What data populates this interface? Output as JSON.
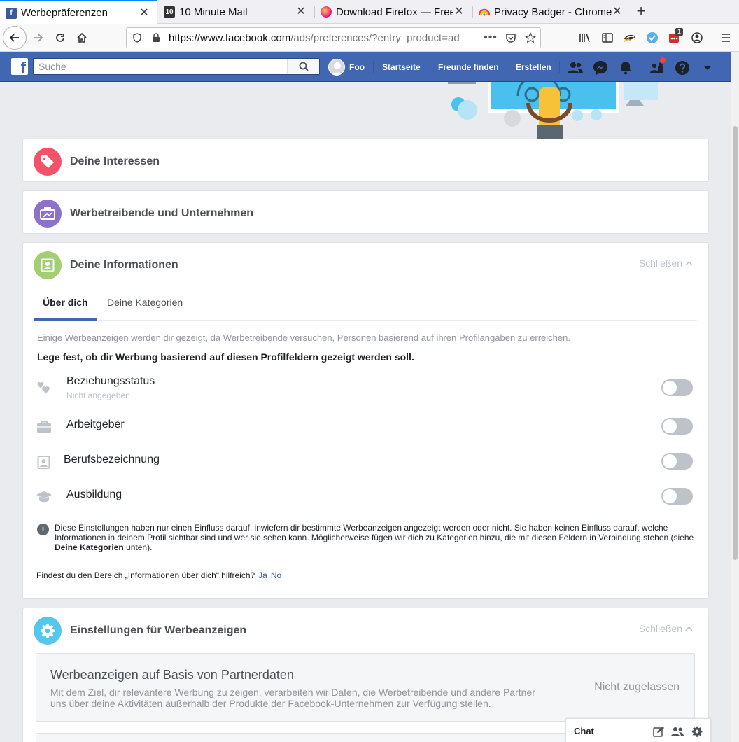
{
  "browser": {
    "tabs": [
      {
        "title": "Werbepräferenzen",
        "active": true
      },
      {
        "title": "10 Minute Mail",
        "active": false
      },
      {
        "title": "Download Firefox — Free",
        "active": false
      },
      {
        "title": "Privacy Badger - Chrome",
        "active": false
      }
    ],
    "url_host": "https://www.facebook.com",
    "url_path": "/ads/preferences/?entry_product=ad",
    "extension_badge": "1"
  },
  "fb": {
    "search_placeholder": "Suche",
    "profile_name": "Foo",
    "nav": {
      "home": "Startseite",
      "find_friends": "Freunde finden",
      "create": "Erstellen"
    }
  },
  "sections": {
    "interests": "Deine Interessen",
    "advertisers": "Werbetreibende und Unternehmen",
    "info": {
      "title": "Deine Informationen",
      "close": "Schließen",
      "tabs": [
        "Über dich",
        "Deine Kategorien"
      ],
      "intro": "Einige Werbeanzeigen werden dir gezeigt, da Werbetreibende versuchen, Personen basierend auf ihren Profilangaben zu erreichen.",
      "instruction": "Lege fest, ob dir Werbung basierend auf diesen Profilfeldern gezeigt werden soll.",
      "fields": [
        {
          "label": "Beziehungsstatus",
          "sub": "Nicht angegeben",
          "enabled": false
        },
        {
          "label": "Arbeitgeber",
          "sub": "",
          "enabled": false
        },
        {
          "label": "Berufsbezeichnung",
          "sub": "",
          "enabled": false
        },
        {
          "label": "Ausbildung",
          "sub": "",
          "enabled": false
        }
      ],
      "note_a": "Diese Einstellungen haben nur einen Einfluss darauf, inwiefern dir bestimmte Werbeanzeigen angezeigt werden oder nicht. Sie haben keinen Einfluss darauf, welche Informationen in deinem Profil sichtbar sind und wer sie sehen kann. Möglicherweise fügen wir dich zu Kategorien hinzu, die mit diesen Feldern in Verbindung stehen (siehe ",
      "note_bold": "Deine Kategorien",
      "note_b": " unten).",
      "feedback_q": "Findest du den Bereich „Informationen über dich“ hilfreich?",
      "feedback_yes": "Ja",
      "feedback_no": "No"
    },
    "ad_settings": {
      "title": "Einstellungen für Werbeanzeigen",
      "close": "Schließen",
      "partner_title": "Werbeanzeigen auf Basis von Partnerdaten",
      "partner_desc_a": "Mit dem Ziel, dir relevantere Werbung zu zeigen, verarbeiten wir Daten, die Werbetreibende und andere Partner uns über deine Aktivitäten außerhalb der ",
      "partner_link": "Produkte der Facebook-Unternehmen",
      "partner_desc_b": " zur Verfügung stellen.",
      "partner_value": "Nicht zugelassen"
    }
  },
  "chat": {
    "label": "Chat"
  },
  "colors": {
    "fb_blue": "#4267b2",
    "interests": "#f35369",
    "advertisers": "#8c72cb",
    "info": "#a3ce71",
    "ad_settings": "#54c7ec"
  }
}
